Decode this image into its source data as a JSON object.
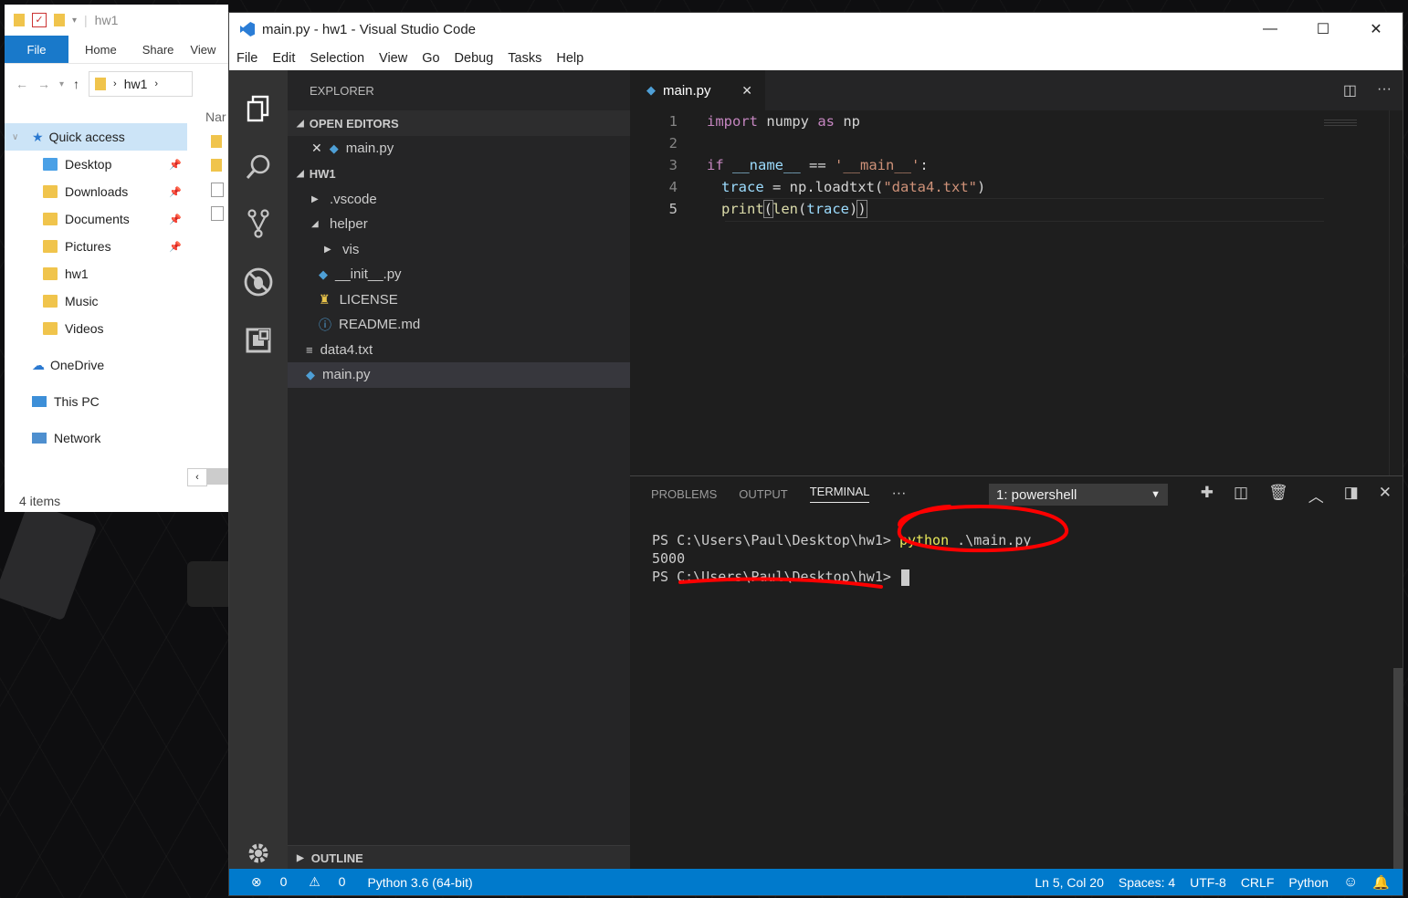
{
  "explorer": {
    "title": "hw1",
    "ribbon_tabs": [
      "File",
      "Home",
      "Share",
      "View"
    ],
    "address": "hw1",
    "nav": [
      {
        "label": "Quick access",
        "pinned": false,
        "selected": true
      },
      {
        "label": "Desktop",
        "pinned": true
      },
      {
        "label": "Downloads",
        "pinned": true
      },
      {
        "label": "Documents",
        "pinned": true
      },
      {
        "label": "Pictures",
        "pinned": true
      },
      {
        "label": "hw1",
        "pinned": false
      },
      {
        "label": "Music",
        "pinned": false
      },
      {
        "label": "Videos",
        "pinned": false
      },
      {
        "label": "OneDrive",
        "pinned": false
      },
      {
        "label": "This PC",
        "pinned": false
      },
      {
        "label": "Network",
        "pinned": false
      }
    ],
    "column_header": "Nar",
    "status": "4 items"
  },
  "vscode": {
    "title": "main.py - hw1 - Visual Studio Code",
    "menu": [
      "File",
      "Edit",
      "Selection",
      "View",
      "Go",
      "Debug",
      "Tasks",
      "Help"
    ],
    "sidebar": {
      "header": "EXPLORER",
      "open_editors_label": "OPEN EDITORS",
      "open_editor_file": "main.py",
      "folder_label": "HW1",
      "tree": [
        {
          "label": ".vscode",
          "type": "folder-collapsed",
          "indent": 1
        },
        {
          "label": "helper",
          "type": "folder-open",
          "indent": 1
        },
        {
          "label": "vis",
          "type": "folder-collapsed",
          "indent": 2
        },
        {
          "label": "__init__.py",
          "type": "python",
          "indent": 2
        },
        {
          "label": "LICENSE",
          "type": "license",
          "indent": 2
        },
        {
          "label": "README.md",
          "type": "info",
          "indent": 2
        },
        {
          "label": "data4.txt",
          "type": "text",
          "indent": 1
        },
        {
          "label": "main.py",
          "type": "python",
          "indent": 1,
          "selected": true
        }
      ],
      "outline_label": "OUTLINE"
    },
    "tab": {
      "label": "main.py"
    },
    "code": {
      "line_numbers": [
        "1",
        "2",
        "3",
        "4",
        "5"
      ],
      "l1": {
        "kw": "import",
        "mod": " numpy ",
        "as": "as",
        "alias": " np"
      },
      "l3": {
        "kw": "if",
        "sp": " ",
        "name": "__name__",
        "op": " == ",
        "str": "'__main__'",
        "colon": ":"
      },
      "l4": {
        "var": "trace",
        "op": " = ",
        "call": "np.loadtxt(",
        "str": "\"data4.txt\"",
        "close": ")"
      },
      "l5": {
        "fn": "print",
        "p1": "(",
        "fn2": "len",
        "p2": "(",
        "arg": "trace",
        "p3": ")",
        "p4": ")"
      }
    },
    "panel": {
      "tabs": [
        "PROBLEMS",
        "OUTPUT",
        "TERMINAL"
      ],
      "more": "···",
      "terminal_select": "1: powershell",
      "terminal": {
        "prompt1": "PS C:\\Users\\Paul\\Desktop\\hw1> ",
        "cmd_python": "python",
        "cmd_rest": " .\\main.py",
        "output": "5000",
        "prompt2": "PS C:\\Users\\Paul\\Desktop\\hw1> "
      }
    },
    "status": {
      "errors": "0",
      "warnings": "0",
      "interpreter": "Python 3.6 (64-bit)",
      "position": "Ln 5, Col 20",
      "spaces": "Spaces: 4",
      "encoding": "UTF-8",
      "eol": "CRLF",
      "language": "Python"
    }
  },
  "colors": {
    "statusbar": "#007acc",
    "annotation": "#ff0000",
    "keyword": "#c586c0",
    "string": "#ce9178"
  }
}
